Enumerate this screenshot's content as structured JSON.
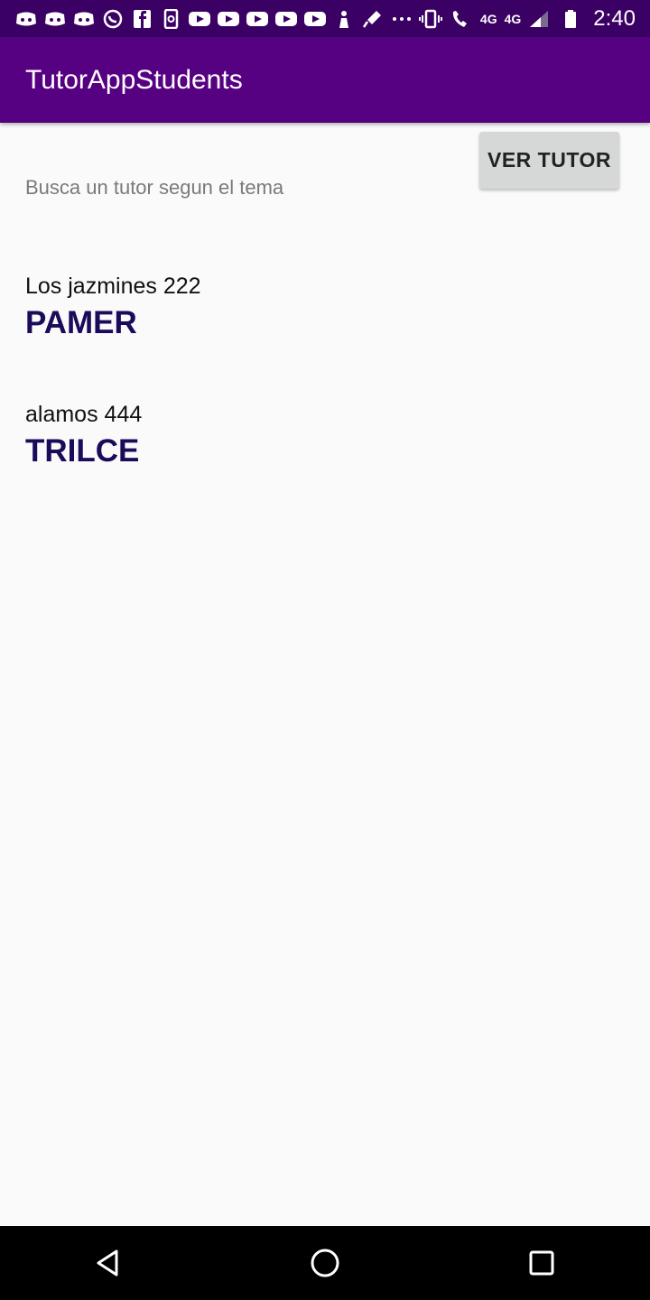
{
  "status_bar": {
    "network_left": "4G",
    "network_right": "4G",
    "time": "2:40",
    "icons": [
      "discord-icon",
      "discord-icon",
      "discord-icon",
      "whatsapp-icon",
      "facebook-icon",
      "phone-sync-icon",
      "youtube-icon",
      "youtube-icon",
      "youtube-icon",
      "youtube-icon",
      "youtube-icon",
      "cleaner-icon",
      "mic-icon",
      "more-icon",
      "vibrate-icon",
      "wifi-call-icon",
      "signal-icon",
      "battery-icon"
    ]
  },
  "app_bar": {
    "title": "TutorAppStudents"
  },
  "actions": {
    "ver_tutor_label": "VER TUTOR"
  },
  "search": {
    "hint": "Busca un tutor segun el tema"
  },
  "list": {
    "items": [
      {
        "address": "Los jazmines 222",
        "name": "PAMER"
      },
      {
        "address": "alamos 444",
        "name": "TRILCE"
      }
    ]
  },
  "colors": {
    "status_bar": "#3a0064",
    "app_bar": "#560082",
    "title_text": "#1c0a5a",
    "button_bg": "#d6d7d7"
  }
}
